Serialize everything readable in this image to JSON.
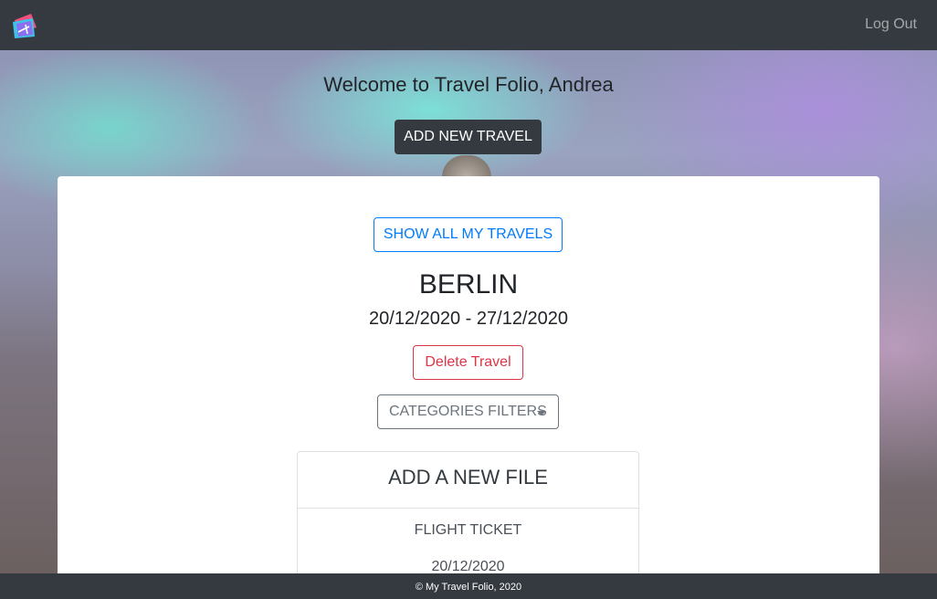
{
  "navbar": {
    "logo_icon": "ticket-logo-icon",
    "logout_label": "Log Out"
  },
  "hero": {
    "welcome_text": "Welcome to Travel Folio, Andrea",
    "add_travel_label": "ADD NEW TRAVEL"
  },
  "travel": {
    "show_all_label": "SHOW ALL MY TRAVELS",
    "city": "BERLIN",
    "dates": "20/12/2020 - 27/12/2020",
    "delete_label": "Delete Travel",
    "filters_label": "CATEGORIES FILTERS"
  },
  "file_card": {
    "title": "ADD A NEW FILE",
    "file_type": "FLIGHT TICKET",
    "file_date": "20/12/2020"
  },
  "footer": {
    "copyright": "© My Travel Folio, 2020"
  },
  "colors": {
    "navbar_bg": "#343a40",
    "primary": "#007bff",
    "danger": "#dc3545",
    "secondary": "#6c757d"
  }
}
